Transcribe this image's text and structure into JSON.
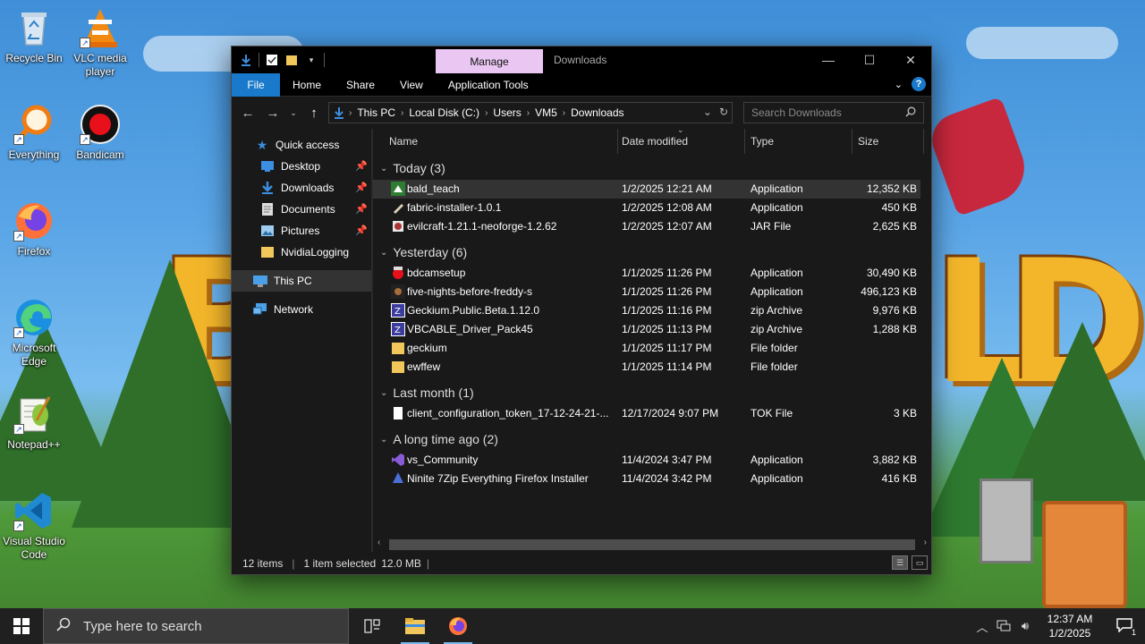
{
  "desktop": {
    "icons": [
      {
        "label": "Recycle Bin",
        "icon": "recycle-bin-icon"
      },
      {
        "label": "VLC media player",
        "icon": "vlc-icon"
      },
      {
        "label": "Everything",
        "icon": "everything-search-icon"
      },
      {
        "label": "Bandicam",
        "icon": "bandicam-icon"
      },
      {
        "label": "Firefox",
        "icon": "firefox-icon"
      },
      {
        "label": "Microsoft Edge",
        "icon": "edge-icon"
      },
      {
        "label": "Notepad++",
        "icon": "notepad-plus-plus-icon"
      },
      {
        "label": "Visual Studio Code",
        "icon": "vscode-icon"
      }
    ]
  },
  "window": {
    "title": "Downloads",
    "context_tab": "Manage",
    "controls": {
      "minimize": "—",
      "maximize": "☐",
      "close": "✕"
    },
    "ribbon_tabs": [
      "File",
      "Home",
      "Share",
      "View",
      "Application Tools"
    ],
    "address": {
      "crumbs": [
        "This PC",
        "Local Disk (C:)",
        "Users",
        "VM5",
        "Downloads"
      ]
    },
    "search_placeholder": "Search Downloads",
    "nav": {
      "quick_access": "Quick access",
      "items": [
        {
          "label": "Desktop",
          "icon": "desktop-folder-icon",
          "pinned": true
        },
        {
          "label": "Downloads",
          "icon": "downloads-folder-icon",
          "pinned": true
        },
        {
          "label": "Documents",
          "icon": "documents-folder-icon",
          "pinned": true
        },
        {
          "label": "Pictures",
          "icon": "pictures-folder-icon",
          "pinned": true
        },
        {
          "label": "NvidiaLogging",
          "icon": "folder-icon",
          "pinned": false
        }
      ],
      "this_pc": "This PC",
      "network": "Network"
    },
    "columns": [
      "Name",
      "Date modified",
      "Type",
      "Size"
    ],
    "groups": [
      {
        "label": "Today (3)",
        "files": [
          {
            "name": "bald_teach",
            "date": "1/2/2025 12:21 AM",
            "type": "Application",
            "size": "12,352 KB",
            "icon": "app-icon",
            "selected": true
          },
          {
            "name": "fabric-installer-1.0.1",
            "date": "1/2/2025 12:08 AM",
            "type": "Application",
            "size": "450 KB",
            "icon": "installer-icon"
          },
          {
            "name": "evilcraft-1.21.1-neoforge-1.2.62",
            "date": "1/2/2025 12:07 AM",
            "type": "JAR File",
            "size": "2,625 KB",
            "icon": "jar-icon"
          }
        ]
      },
      {
        "label": "Yesterday (6)",
        "files": [
          {
            "name": "bdcamsetup",
            "date": "1/1/2025 11:26 PM",
            "type": "Application",
            "size": "30,490 KB",
            "icon": "bandicam-setup-icon"
          },
          {
            "name": "five-nights-before-freddy-s",
            "date": "1/1/2025 11:26 PM",
            "type": "Application",
            "size": "496,123 KB",
            "icon": "game-icon"
          },
          {
            "name": "Geckium.Public.Beta.1.12.0",
            "date": "1/1/2025 11:16 PM",
            "type": "zip Archive",
            "size": "9,976 KB",
            "icon": "zip-icon"
          },
          {
            "name": "VBCABLE_Driver_Pack45",
            "date": "1/1/2025 11:13 PM",
            "type": "zip Archive",
            "size": "1,288 KB",
            "icon": "zip-icon"
          },
          {
            "name": "geckium",
            "date": "1/1/2025 11:17 PM",
            "type": "File folder",
            "size": "",
            "icon": "folder-icon"
          },
          {
            "name": "ewffew",
            "date": "1/1/2025 11:14 PM",
            "type": "File folder",
            "size": "",
            "icon": "folder-icon"
          }
        ]
      },
      {
        "label": "Last month (1)",
        "files": [
          {
            "name": "client_configuration_token_17-12-24-21-...",
            "date": "12/17/2024 9:07 PM",
            "type": "TOK File",
            "size": "3 KB",
            "icon": "file-icon"
          }
        ]
      },
      {
        "label": "A long time ago (2)",
        "files": [
          {
            "name": "vs_Community",
            "date": "11/4/2024 3:47 PM",
            "type": "Application",
            "size": "3,882 KB",
            "icon": "visual-studio-icon"
          },
          {
            "name": "Ninite 7Zip Everything Firefox Installer",
            "date": "11/4/2024 3:42 PM",
            "type": "Application",
            "size": "416 KB",
            "icon": "ninite-icon"
          }
        ]
      }
    ],
    "status": {
      "items": "12 items",
      "selected": "1 item selected",
      "size": "12.0 MB"
    }
  },
  "taskbar": {
    "search_placeholder": "Type here to search",
    "clock_time": "12:37 AM",
    "clock_date": "1/2/2025",
    "notification_count": "1"
  },
  "colors": {
    "accent": "#1979ca",
    "manage_tab": "#e9c7f2",
    "window_bg": "#191919",
    "folder": "#f1c75b"
  }
}
